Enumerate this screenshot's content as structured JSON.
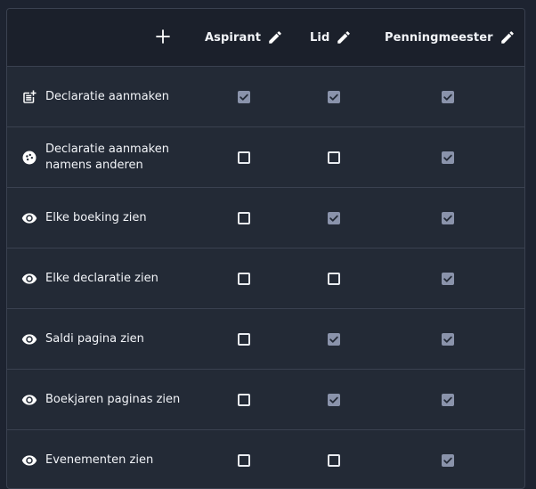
{
  "header": {
    "add_icon": "plus-icon",
    "columns": [
      {
        "label": "Aspirant",
        "icon": "pencil-icon"
      },
      {
        "label": "Lid",
        "icon": "pencil-icon"
      },
      {
        "label": "Penningmeester",
        "icon": "pencil-icon"
      }
    ]
  },
  "rows": [
    {
      "icon": "post-add-icon",
      "label": "Declaratie aanmaken",
      "checks": [
        true,
        true,
        true
      ]
    },
    {
      "icon": "face-icon",
      "label": "Declaratie aanmaken namens anderen",
      "checks": [
        false,
        false,
        true
      ]
    },
    {
      "icon": "eye-icon",
      "label": "Elke boeking zien",
      "checks": [
        false,
        true,
        true
      ]
    },
    {
      "icon": "eye-icon",
      "label": "Elke declaratie zien",
      "checks": [
        false,
        false,
        true
      ]
    },
    {
      "icon": "eye-icon",
      "label": "Saldi pagina zien",
      "checks": [
        false,
        true,
        true
      ]
    },
    {
      "icon": "eye-icon",
      "label": "Boekjaren paginas zien",
      "checks": [
        false,
        true,
        true
      ]
    },
    {
      "icon": "eye-icon",
      "label": "Evenementen zien",
      "checks": [
        false,
        false,
        true
      ]
    }
  ],
  "colors": {
    "page_bg": "#1d2330",
    "header_bg": "#1b202b",
    "row_bg": "#232a36",
    "border": "#3a4150",
    "checked_fill": "#8a93ab",
    "text": "#f2f4f8"
  }
}
